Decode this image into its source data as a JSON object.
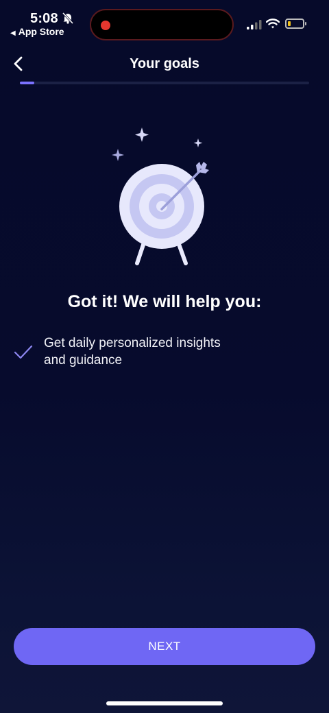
{
  "status_bar": {
    "time": "5:08",
    "back_app": "App Store",
    "icons": [
      "bell-slash-icon",
      "record-dot-icon",
      "signal-icon",
      "wifi-icon",
      "battery-icon"
    ],
    "battery_level": 0.15,
    "colors": {
      "record_dot": "#e7372f",
      "battery_fill": "#f2c21b"
    }
  },
  "nav": {
    "title": "Your goals",
    "back_icon": "chevron-left-icon"
  },
  "progress": {
    "value": 0.05,
    "color": "#7b72ff"
  },
  "illustration": {
    "icon": "target-with-arrow-icon",
    "sparkles": 3
  },
  "headline": "Got it! We will help you:",
  "benefits": [
    {
      "icon": "checkmark-icon",
      "text_line1": "Get daily personalized insights",
      "text_line2": "and guidance"
    }
  ],
  "next_button": {
    "label": "NEXT",
    "color": "#6f67f4"
  },
  "colors": {
    "background": "#070b2d",
    "accent": "#7b72ff",
    "text": "#ffffff"
  }
}
